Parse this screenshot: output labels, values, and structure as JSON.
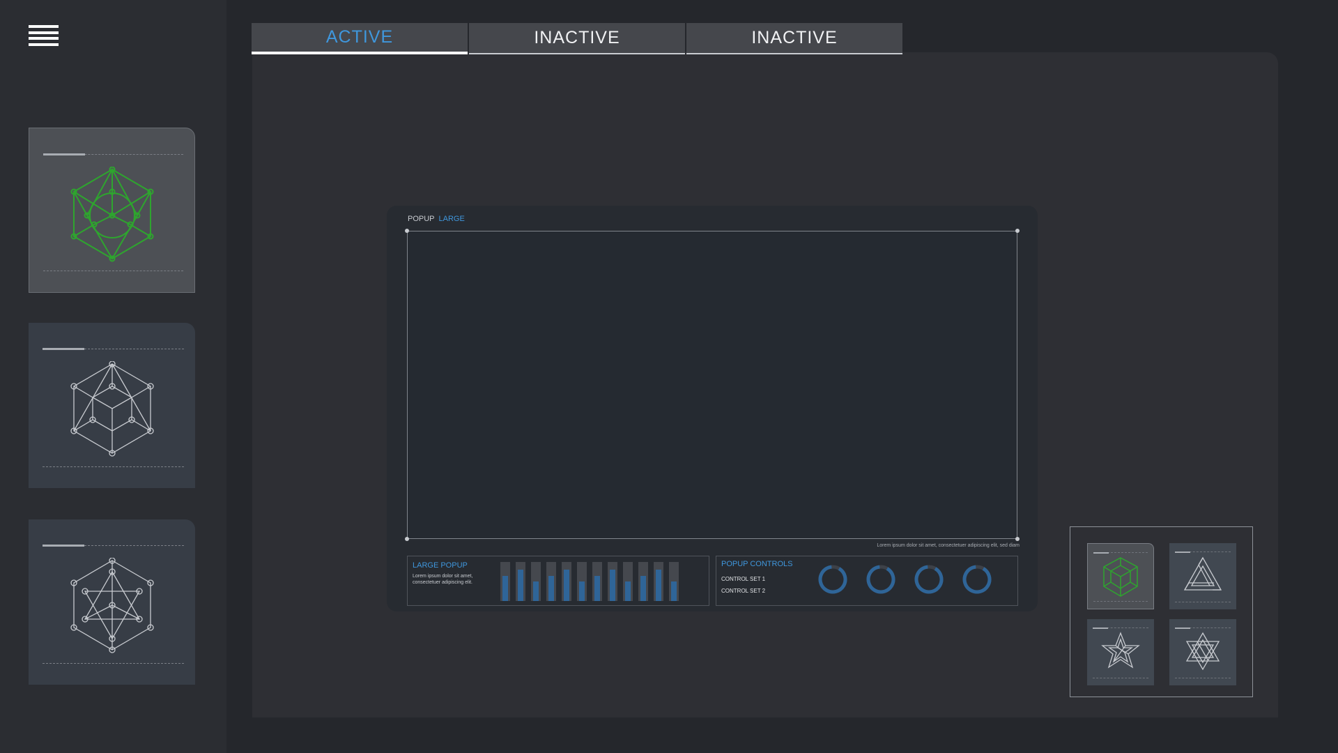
{
  "icons": {
    "menu": "hamburger-menu-icon"
  },
  "colors": {
    "accent": "#3f97dd",
    "selected_icon": "#2ea52e",
    "inactive_icon": "#c8cbd0",
    "bar_fill": "#2f6598"
  },
  "sidebar": {
    "cards": [
      {
        "icon": "hexagon-circle-icon",
        "selected": true
      },
      {
        "icon": "hexagon-cube-icon",
        "selected": false
      },
      {
        "icon": "hexagon-star-icon",
        "selected": false
      }
    ]
  },
  "tabs": [
    {
      "label": "ACTIVE",
      "active": true
    },
    {
      "label": "INACTIVE",
      "active": false
    },
    {
      "label": "INACTIVE",
      "active": false
    }
  ],
  "popup": {
    "title": "POPUP",
    "title_accent": "LARGE",
    "caption": "Lorem ipsum dolor sit amet, consectetuer adipiscing elit, sed diam",
    "large_popup": {
      "title": "LARGE POPUP",
      "description": "Lorem ipsum dolor sit amet, consectetuer adipiscing elit.",
      "bar_levels": [
        0.65,
        0.8,
        0.5,
        0.65,
        0.8,
        0.5,
        0.65,
        0.8,
        0.5,
        0.65,
        0.8,
        0.5
      ]
    },
    "popup_controls": {
      "title": "POPUP CONTROLS",
      "control_set_1": "CONTROL SET 1",
      "control_set_2": "CONTROL SET 2",
      "knob_count": 4
    }
  },
  "mini_panel": {
    "cards": [
      {
        "icon": "cube-icon",
        "selected": true
      },
      {
        "icon": "impossible-triangle-icon",
        "selected": false
      },
      {
        "icon": "star-knot-icon",
        "selected": false
      },
      {
        "icon": "hexagram-knot-icon",
        "selected": false
      }
    ]
  }
}
